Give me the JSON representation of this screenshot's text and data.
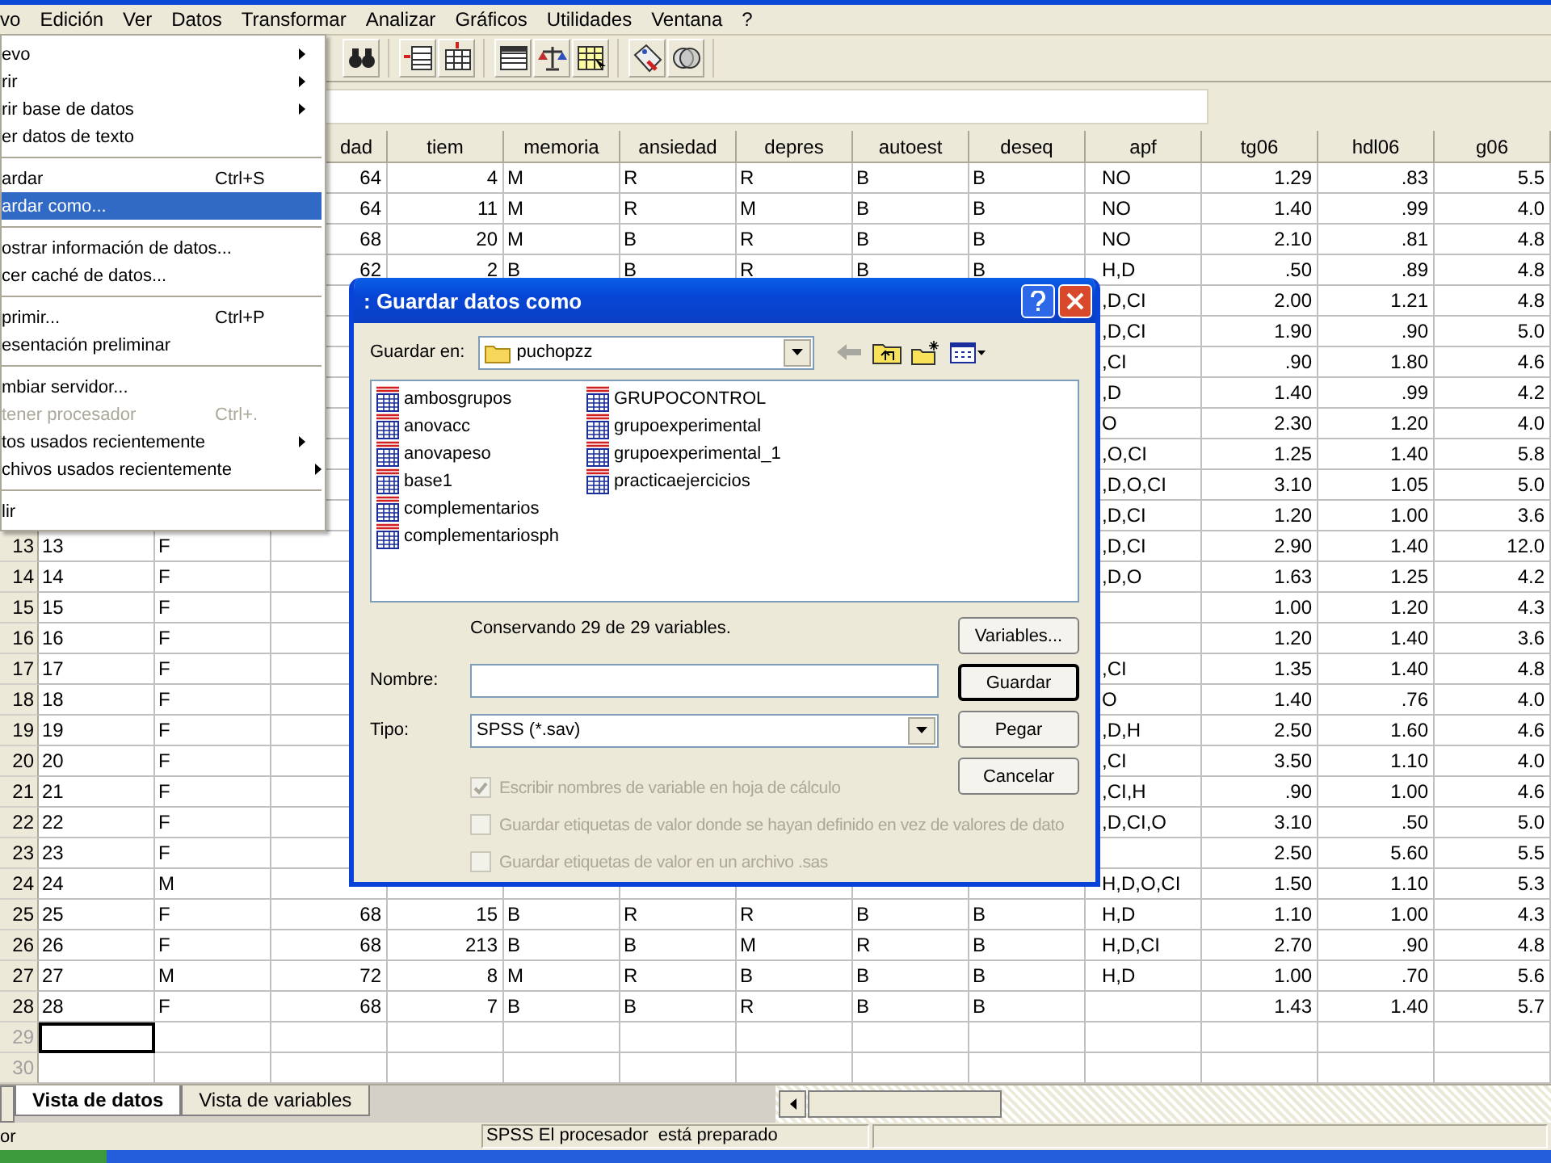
{
  "menu_bar": [
    "vo",
    "Edición",
    "Ver",
    "Datos",
    "Transformar",
    "Analizar",
    "Gráficos",
    "Utilidades",
    "Ventana",
    "?"
  ],
  "file_menu": {
    "items": [
      {
        "kind": "item",
        "label": "evo",
        "submenu": true,
        "selected": false,
        "disabled": false
      },
      {
        "kind": "item",
        "label": "rir",
        "submenu": true,
        "selected": false,
        "disabled": false
      },
      {
        "kind": "item",
        "label": "rir base de datos",
        "submenu": true,
        "selected": false,
        "disabled": false
      },
      {
        "kind": "item",
        "label": "er datos de texto",
        "submenu": false,
        "selected": false,
        "disabled": false
      },
      {
        "kind": "separator"
      },
      {
        "kind": "item",
        "label": "ardar",
        "shortcut": "Ctrl+S",
        "submenu": false,
        "selected": false,
        "disabled": false
      },
      {
        "kind": "item",
        "label": "ardar como...",
        "submenu": false,
        "selected": true,
        "disabled": false
      },
      {
        "kind": "separator"
      },
      {
        "kind": "item",
        "label": "ostrar información de datos...",
        "submenu": false,
        "selected": false,
        "disabled": false
      },
      {
        "kind": "item",
        "label": "cer caché de datos...",
        "submenu": false,
        "selected": false,
        "disabled": false
      },
      {
        "kind": "separator"
      },
      {
        "kind": "item",
        "label": "primir...",
        "shortcut": "Ctrl+P",
        "submenu": false,
        "selected": false,
        "disabled": false
      },
      {
        "kind": "item",
        "label": "esentación preliminar",
        "submenu": false,
        "selected": false,
        "disabled": false
      },
      {
        "kind": "separator"
      },
      {
        "kind": "item",
        "label": "mbiar servidor...",
        "submenu": false,
        "selected": false,
        "disabled": false
      },
      {
        "kind": "item",
        "label": "tener procesador",
        "shortcut": "Ctrl+.",
        "submenu": false,
        "selected": false,
        "disabled": true
      },
      {
        "kind": "item",
        "label": "tos usados recientemente",
        "submenu": true,
        "selected": false,
        "disabled": false
      },
      {
        "kind": "item",
        "label": "chivos usados recientemente",
        "submenu": true,
        "selected": false,
        "disabled": false
      },
      {
        "kind": "separator"
      },
      {
        "kind": "item",
        "label": "lir",
        "submenu": false,
        "selected": false,
        "disabled": false
      }
    ]
  },
  "grid": {
    "columns": [
      {
        "kind": "text"
      },
      {
        "kind": "text"
      },
      {
        "kind": "number",
        "label": "dad"
      },
      {
        "kind": "number",
        "label": "tiem"
      },
      {
        "kind": "text",
        "label": "memoria"
      },
      {
        "kind": "text",
        "label": "ansiedad"
      },
      {
        "kind": "text",
        "label": "depres"
      },
      {
        "kind": "text",
        "label": "autoest"
      },
      {
        "kind": "text",
        "label": "deseq"
      },
      {
        "kind": "text",
        "label": "apf"
      },
      {
        "kind": "number",
        "label": "tg06"
      },
      {
        "kind": "number",
        "label": "hdl06"
      },
      {
        "kind": "number",
        "label": "g06"
      }
    ],
    "rows": [
      {
        "selected": false,
        "cells": [
          null,
          null,
          "64",
          "4",
          "M",
          "R",
          "R",
          "B",
          "B",
          "NO",
          "1.29",
          ".83",
          "5.5"
        ]
      },
      {
        "selected": false,
        "cells": [
          null,
          null,
          "64",
          "11",
          "M",
          "R",
          "M",
          "B",
          "B",
          "NO",
          "1.40",
          ".99",
          "4.0"
        ]
      },
      {
        "selected": false,
        "cells": [
          null,
          null,
          "68",
          "20",
          "M",
          "B",
          "R",
          "B",
          "B",
          "NO",
          "2.10",
          ".81",
          "4.8"
        ]
      },
      {
        "selected": false,
        "cells": [
          null,
          null,
          "62",
          "2",
          "B",
          "B",
          "R",
          "B",
          "B",
          "H,D",
          ".50",
          ".89",
          "4.8"
        ]
      },
      {
        "selected": false,
        "cells": [
          null,
          null,
          null,
          null,
          null,
          null,
          null,
          null,
          null,
          ",D,CI",
          "2.00",
          "1.21",
          "4.8"
        ]
      },
      {
        "selected": false,
        "cells": [
          null,
          null,
          null,
          null,
          null,
          null,
          null,
          null,
          null,
          ",D,CI",
          "1.90",
          ".90",
          "5.0"
        ]
      },
      {
        "selected": false,
        "cells": [
          null,
          null,
          null,
          null,
          null,
          null,
          null,
          null,
          null,
          ",CI",
          ".90",
          "1.80",
          "4.6"
        ]
      },
      {
        "selected": false,
        "cells": [
          null,
          null,
          null,
          null,
          null,
          null,
          null,
          null,
          null,
          ",D",
          "1.40",
          ".99",
          "4.2"
        ]
      },
      {
        "selected": false,
        "cells": [
          null,
          null,
          null,
          null,
          null,
          null,
          null,
          null,
          null,
          "O",
          "2.30",
          "1.20",
          "4.0"
        ]
      },
      {
        "selected": false,
        "cells": [
          null,
          null,
          null,
          null,
          null,
          null,
          null,
          null,
          null,
          ",O,CI",
          "1.25",
          "1.40",
          "5.8"
        ]
      },
      {
        "selected": false,
        "cells": [
          null,
          null,
          null,
          null,
          null,
          null,
          null,
          null,
          null,
          ",D,O,CI",
          "3.10",
          "1.05",
          "5.0"
        ]
      },
      {
        "selected": false,
        "cells": [
          null,
          null,
          null,
          null,
          null,
          null,
          null,
          null,
          null,
          ",D,CI",
          "1.20",
          "1.00",
          "3.6"
        ]
      },
      {
        "number": "13",
        "selected": false,
        "cells": [
          "13",
          "F",
          null,
          null,
          null,
          null,
          null,
          null,
          null,
          ",D,CI",
          "2.90",
          "1.40",
          "12.0"
        ]
      },
      {
        "number": "14",
        "selected": false,
        "cells": [
          "14",
          "F",
          null,
          null,
          null,
          null,
          null,
          null,
          null,
          ",D,O",
          "1.63",
          "1.25",
          "4.2"
        ]
      },
      {
        "number": "15",
        "selected": false,
        "cells": [
          "15",
          "F",
          null,
          null,
          null,
          null,
          null,
          null,
          null,
          null,
          "1.00",
          "1.20",
          "4.3"
        ]
      },
      {
        "number": "16",
        "selected": false,
        "cells": [
          "16",
          "F",
          null,
          null,
          null,
          null,
          null,
          null,
          null,
          null,
          "1.20",
          "1.40",
          "3.6"
        ]
      },
      {
        "number": "17",
        "selected": false,
        "cells": [
          "17",
          "F",
          null,
          null,
          null,
          null,
          null,
          null,
          null,
          ",CI",
          "1.35",
          "1.40",
          "4.8"
        ]
      },
      {
        "number": "18",
        "selected": false,
        "cells": [
          "18",
          "F",
          null,
          null,
          null,
          null,
          null,
          null,
          null,
          "O",
          "1.40",
          ".76",
          "4.0"
        ]
      },
      {
        "number": "19",
        "selected": false,
        "cells": [
          "19",
          "F",
          null,
          null,
          null,
          null,
          null,
          null,
          null,
          ",D,H",
          "2.50",
          "1.60",
          "4.6"
        ]
      },
      {
        "number": "20",
        "selected": false,
        "cells": [
          "20",
          "F",
          null,
          null,
          null,
          null,
          null,
          null,
          null,
          ",CI",
          "3.50",
          "1.10",
          "4.0"
        ]
      },
      {
        "number": "21",
        "selected": false,
        "cells": [
          "21",
          "F",
          null,
          null,
          null,
          null,
          null,
          null,
          null,
          ",CI,H",
          ".90",
          "1.00",
          "4.6"
        ]
      },
      {
        "number": "22",
        "selected": false,
        "cells": [
          "22",
          "F",
          null,
          null,
          null,
          null,
          null,
          null,
          null,
          ",D,CI,O",
          "3.10",
          ".50",
          "5.0"
        ]
      },
      {
        "number": "23",
        "selected": false,
        "cells": [
          "23",
          "F",
          null,
          null,
          null,
          null,
          null,
          null,
          null,
          null,
          "2.50",
          "5.60",
          "5.5"
        ]
      },
      {
        "number": "24",
        "selected": false,
        "cells": [
          "24",
          "M",
          null,
          null,
          null,
          null,
          null,
          null,
          null,
          "H,D,O,CI",
          "1.50",
          "1.10",
          "5.3"
        ]
      },
      {
        "number": "25",
        "selected": false,
        "cells": [
          "25",
          "F",
          "68",
          "15",
          "B",
          "R",
          "R",
          "B",
          "B",
          "H,D",
          "1.10",
          "1.00",
          "4.3"
        ]
      },
      {
        "number": "26",
        "selected": false,
        "cells": [
          "26",
          "F",
          "68",
          "213",
          "B",
          "B",
          "M",
          "R",
          "B",
          "H,D,CI",
          "2.70",
          ".90",
          "4.8"
        ]
      },
      {
        "number": "27",
        "selected": false,
        "cells": [
          "27",
          "M",
          "72",
          "8",
          "M",
          "R",
          "B",
          "B",
          "B",
          "H,D",
          "1.00",
          ".70",
          "5.6"
        ]
      },
      {
        "number": "28",
        "selected": false,
        "cells": [
          "28",
          "F",
          "68",
          "7",
          "B",
          "B",
          "R",
          "B",
          "B",
          null,
          "1.43",
          "1.40",
          "5.7"
        ]
      },
      {
        "number": "29",
        "selected": true
      },
      {
        "number": "30",
        "selected": false
      }
    ]
  },
  "dialog": {
    "title": ": Guardar datos como",
    "location_label": "Guardar en:",
    "location": "puchopzz",
    "files": [
      "ambosgrupos",
      "anovacc",
      "anovapeso",
      "base1",
      "complementarios",
      "complementariosph",
      "GRUPOCONTROL",
      "grupoexperimental",
      "grupoexperimental_1",
      "practicaejercicios"
    ],
    "info": "Conservando 29 de 29 variables.",
    "name_label": "Nombre:",
    "type_label": "Tipo:",
    "type": "SPSS (*.sav)",
    "buttons": [
      {
        "label": "Variables...",
        "default": false
      },
      {
        "label": "Guardar",
        "default": true
      },
      {
        "label": "Pegar",
        "default": false
      },
      {
        "label": "Cancelar",
        "default": false
      }
    ],
    "options": [
      {
        "label": "Escribir nombres de variable en hoja de cálculo",
        "checked": true,
        "disabled": true
      },
      {
        "label": "Guardar etiquetas de valor donde se hayan definido en vez de valores de dato",
        "checked": false,
        "disabled": true
      },
      {
        "label": "Guardar etiquetas de valor en un archivo .sas",
        "checked": false,
        "disabled": true
      }
    ]
  },
  "tabs": [
    {
      "label": "Vista de datos",
      "selected": true
    },
    {
      "label": "Vista de variables",
      "selected": false
    }
  ],
  "status_bar": {
    "left": "or",
    "message": "SPSS El procesador  está preparado"
  }
}
